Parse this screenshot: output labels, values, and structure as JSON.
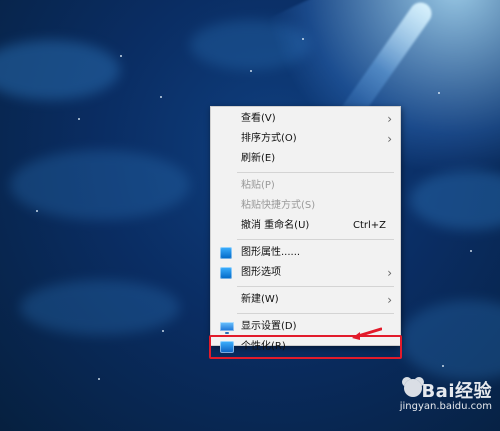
{
  "context_menu": {
    "items": [
      {
        "label": "查看(V)",
        "has_submenu": true,
        "enabled": true
      },
      {
        "label": "排序方式(O)",
        "has_submenu": true,
        "enabled": true
      },
      {
        "label": "刷新(E)",
        "has_submenu": false,
        "enabled": true
      },
      {
        "label": "粘贴(P)",
        "has_submenu": false,
        "enabled": false
      },
      {
        "label": "粘贴快捷方式(S)",
        "has_submenu": false,
        "enabled": false
      },
      {
        "label": "撤消 重命名(U)",
        "shortcut": "Ctrl+Z",
        "has_submenu": false,
        "enabled": true
      },
      {
        "label": "图形属性......",
        "icon": "graphics-icon",
        "has_submenu": false,
        "enabled": true
      },
      {
        "label": "图形选项",
        "icon": "graphics-icon",
        "has_submenu": true,
        "enabled": true
      },
      {
        "label": "新建(W)",
        "has_submenu": true,
        "enabled": true
      },
      {
        "label": "显示设置(D)",
        "icon": "display-settings-icon",
        "has_submenu": false,
        "enabled": true
      },
      {
        "label": "个性化(R)",
        "icon": "personalize-icon",
        "has_submenu": false,
        "enabled": true,
        "highlighted": true
      }
    ]
  },
  "watermark": {
    "brand_left": "Bai",
    "brand_right": "经验",
    "url": "jingyan.baidu.com"
  },
  "colors": {
    "menu_bg": "#f2f2f2",
    "disabled_text": "#9a9a9a",
    "highlight_red": "#e21b2b"
  }
}
